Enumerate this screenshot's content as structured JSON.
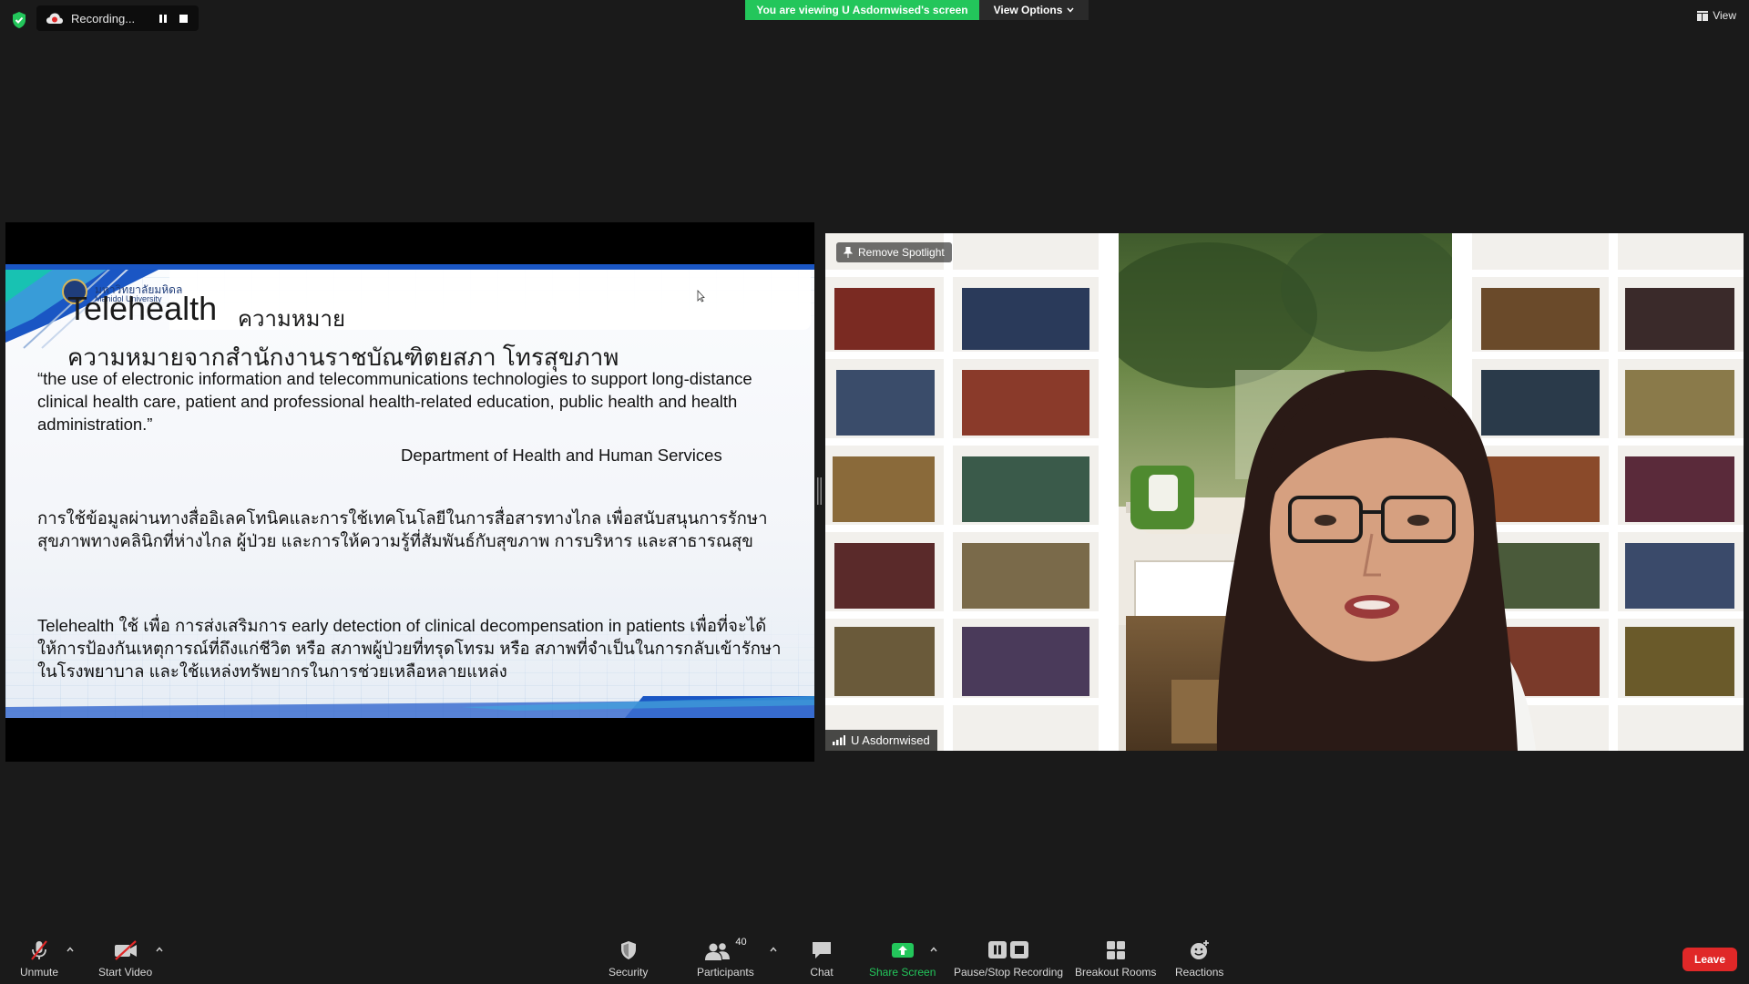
{
  "top_bar": {
    "recording_text": "Recording...",
    "viewing_banner": "You are viewing U Asdornwised's screen",
    "view_options_label": "View Options",
    "view_label": "View"
  },
  "shared_slide": {
    "logo_line1": "มหาวิทยาลัยมหิดล",
    "logo_line2": "Mahidol University",
    "title": "Telehealth",
    "title_thai": "ความหมาย",
    "subhead": "ความหมายจากสำนักงานราชบัณฑิตยสภา  โทรสุขภาพ",
    "quote": "“the use of electronic information and telecommunications technologies to support long-distance clinical health care, patient and professional health-related education, public health and health administration.”",
    "source": "Department of Health and Human Services",
    "thai_definition": "การใช้ข้อมูลผ่านทางสื่ออิเลคโทนิคและการใช้เทคโนโลยีในการสื่อสารทางไกล เพื่อสนับสนุนการรักษาสุขภาพทางคลินิกที่ห่างไกล ผู้ป่วย และการให้ความรู้ที่สัมพันธ์กับสุขภาพ การบริหาร และสาธารณสุข",
    "usage": "Telehealth  ใช้ เพื่อ การส่งเสริมการ early detection of clinical decompensation in patients เพื่อที่จะได้ให้การป้องกันเหตุการณ์ที่ถึงแก่ชีวิต หรือ สภาพผู้ป่วยที่ทรุดโทรม หรือ สภาพที่จำเป็นในการกลับเข้ารักษาในโรงพยาบาล และใช้แหล่งทรัพยากรในการช่วยเหลือหลายแหล่ง"
  },
  "video": {
    "remove_spotlight_label": "Remove Spotlight",
    "participant_name": "U Asdornwised"
  },
  "toolbar": {
    "unmute_label": "Unmute",
    "start_video_label": "Start Video",
    "security_label": "Security",
    "participants_label": "Participants",
    "participants_count": "40",
    "chat_label": "Chat",
    "share_screen_label": "Share Screen",
    "pause_stop_label": "Pause/Stop Recording",
    "breakout_label": "Breakout Rooms",
    "reactions_label": "Reactions",
    "leave_label": "Leave"
  },
  "colors": {
    "background": "#1a1a1a",
    "banner_green": "#23c65b",
    "share_green": "#23c65b",
    "leave_red": "#e02828",
    "muted_red": "#e02828",
    "slide_blue": "#1a56c4"
  },
  "icons": [
    "shield-icon",
    "cloud-record-icon",
    "pause-icon",
    "stop-icon",
    "chevron-down-icon",
    "view-grid-icon",
    "pin-icon",
    "signal-icon",
    "microphone-muted-icon",
    "video-off-icon",
    "security-shield-icon",
    "participants-icon",
    "chat-icon",
    "share-screen-icon",
    "pause-stop-icon",
    "breakout-rooms-icon",
    "reactions-icon"
  ]
}
